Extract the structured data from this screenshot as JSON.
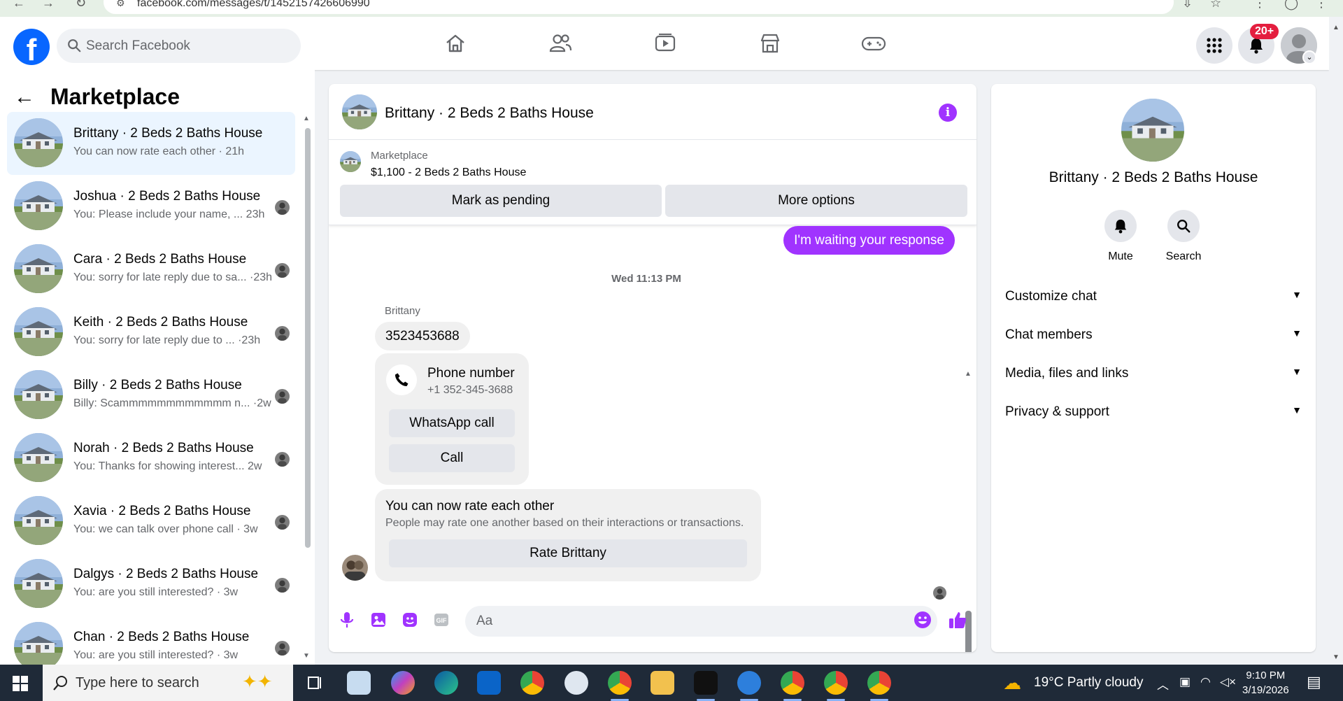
{
  "browser": {
    "url": "facebook.com/messages/t/1452157426606990"
  },
  "topbar": {
    "logo": "f",
    "search_placeholder": "Search Facebook",
    "notif_count": "20+"
  },
  "sidebar": {
    "back": "←",
    "title": "Marketplace",
    "conversations": [
      {
        "title": "Brittany · 2 Beds 2 Baths House",
        "subtitle": "You can now rate each other · 21h",
        "active": true
      },
      {
        "title": "Joshua · 2 Beds 2 Baths House",
        "subtitle": "You: Please include your name, ... 23h"
      },
      {
        "title": "Cara · 2 Beds 2 Baths House",
        "subtitle": "You: sorry for late reply due to sa... ·23h"
      },
      {
        "title": "Keith · 2 Beds 2 Baths House",
        "subtitle": "You: sorry for late reply due to ... ·23h"
      },
      {
        "title": "Billy · 2 Beds 2 Baths House",
        "subtitle": "Billy: Scammmmmmmmmmmm n... ·2w"
      },
      {
        "title": "Norah · 2 Beds 2 Baths House",
        "subtitle": "You: Thanks for showing interest... 2w"
      },
      {
        "title": "Xavia · 2 Beds 2 Baths House",
        "subtitle": "You: we can talk over phone call · 3w"
      },
      {
        "title": "Dalgys · 2 Beds 2 Baths House",
        "subtitle": "You: are you still interested? · 3w"
      },
      {
        "title": "Chan · 2 Beds 2 Baths House",
        "subtitle": "You: are you still interested? · 3w"
      }
    ]
  },
  "chat": {
    "title": "Brittany · 2 Beds 2 Baths House",
    "marketplace_label": "Marketplace",
    "listing": "$1,100 - 2 Beds 2 Baths House",
    "mark_pending": "Mark as pending",
    "more_options": "More options",
    "my_message": "I'm waiting your response",
    "timestamp": "Wed 11:13 PM",
    "sender": "Brittany",
    "their_message": "3523453688",
    "phone_card": {
      "title": "Phone number",
      "number": "+1 352-345-3688",
      "whatsapp": "WhatsApp call",
      "call": "Call"
    },
    "rate_card": {
      "title": "You can now rate each other",
      "subtitle": "People may rate one another based on their interactions or transactions.",
      "button": "Rate Brittany"
    },
    "composer_placeholder": "Aa"
  },
  "info": {
    "name": "Brittany · 2 Beds 2 Baths House",
    "mute": "Mute",
    "search": "Search",
    "sections": [
      "Customize chat",
      "Chat members",
      "Media, files and links",
      "Privacy & support"
    ]
  },
  "taskbar": {
    "search_placeholder": "Type here to search",
    "weather": "19°C  Partly cloudy",
    "time": "9:10 PM",
    "date": "3/19/2026"
  },
  "colors": {
    "brand_blue": "#0866ff",
    "messenger_purple": "#a033ff",
    "notif_red": "#e41e3f"
  }
}
